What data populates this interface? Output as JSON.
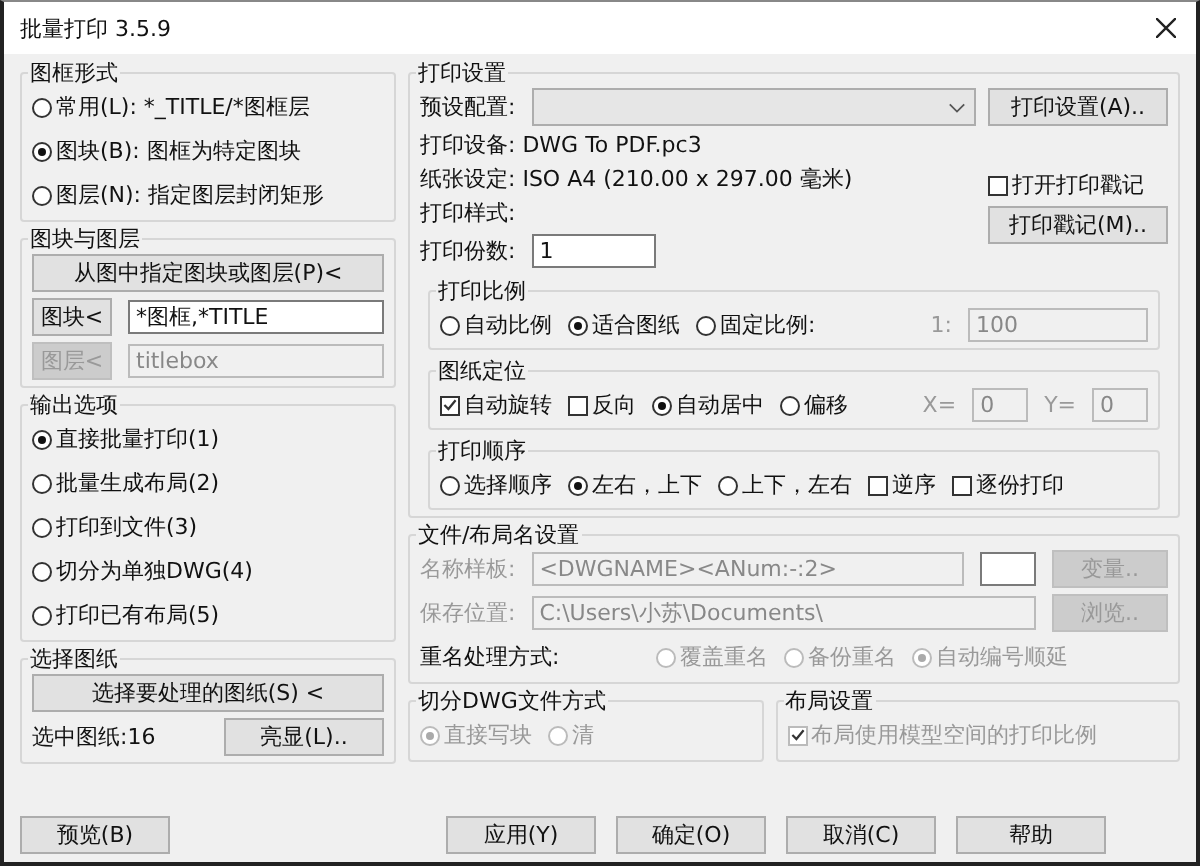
{
  "window": {
    "title": "批量打印 3.5.9"
  },
  "frame_type": {
    "label": "图框形式",
    "options": [
      {
        "label": "常用(L): *_TITLE/*图框层",
        "selected": false
      },
      {
        "label": "图块(B): 图框为特定图块",
        "selected": true
      },
      {
        "label": "图层(N): 指定图层封闭矩形",
        "selected": false
      }
    ]
  },
  "block_layer": {
    "label": "图块与图层",
    "pick_button": "从图中指定图块或图层(P)<",
    "block_button": {
      "label": "图块<",
      "disabled": false
    },
    "block_value": "*图框,*TITLE",
    "layer_button": {
      "label": "图层<",
      "disabled": true
    },
    "layer_value": "titlebox"
  },
  "output": {
    "label": "输出选项",
    "options": [
      {
        "label": "直接批量打印(1)",
        "selected": true
      },
      {
        "label": "批量生成布局(2)",
        "selected": false
      },
      {
        "label": "打印到文件(3)",
        "selected": false
      },
      {
        "label": "切分为单独DWG(4)",
        "selected": false
      },
      {
        "label": "打印已有布局(5)",
        "selected": false
      }
    ]
  },
  "sheets": {
    "label": "选择图纸",
    "select_button": "选择要处理的图纸(S) <",
    "count": "选中图纸:16",
    "highlight_button": "亮显(L).."
  },
  "print_settings": {
    "label": "打印设置",
    "preset_label": "预设配置:",
    "setup_button": "打印设置(A)..",
    "device": "打印设备: DWG To PDF.pc3",
    "paper": "纸张设定: ISO A4 (210.00 x 297.00 毫米)",
    "style": "打印样式:",
    "copies_label": "打印份数:",
    "copies_value": "1",
    "stamp_check": {
      "label": "打开打印戳记",
      "checked": false
    },
    "stamp_button": "打印戳记(M).."
  },
  "scale": {
    "label": "打印比例",
    "options": [
      {
        "label": "自动比例",
        "selected": false
      },
      {
        "label": "适合图纸",
        "selected": true
      },
      {
        "label": "固定比例:",
        "selected": false
      }
    ],
    "ratio_prefix": "1:",
    "ratio_value": "100",
    "ratio_disabled": true
  },
  "position": {
    "label": "图纸定位",
    "items": [
      {
        "kind": "checkbox",
        "label": "自动旋转",
        "checked": true
      },
      {
        "kind": "checkbox",
        "label": "反向",
        "checked": false
      },
      {
        "kind": "radio",
        "label": "自动居中",
        "selected": true
      },
      {
        "kind": "radio",
        "label": "偏移",
        "selected": false
      }
    ],
    "x_label": "X=",
    "x_value": "0",
    "y_label": "Y=",
    "y_value": "0",
    "offset_disabled": true
  },
  "order": {
    "label": "打印顺序",
    "items": [
      {
        "kind": "radio",
        "label": "选择顺序",
        "selected": false
      },
      {
        "kind": "radio",
        "label": "左右，上下",
        "selected": true
      },
      {
        "kind": "radio",
        "label": "上下，左右",
        "selected": false
      },
      {
        "kind": "checkbox",
        "label": "逆序",
        "checked": false
      },
      {
        "kind": "checkbox",
        "label": "逐份打印",
        "checked": false
      }
    ]
  },
  "file_names": {
    "label": "文件/布局名设置",
    "disabled": true,
    "template_label": "名称样板:",
    "template_value": "<DWGNAME><ANum:-:2>",
    "variable_button": "变量..",
    "location_label": "保存位置:",
    "location_value": "C:\\Users\\小苏\\Documents\\",
    "browse_button": "浏览..",
    "rename_label": "重名处理方式:",
    "rename_options": [
      {
        "label": "覆盖重名",
        "selected": false
      },
      {
        "label": "备份重名",
        "selected": false
      },
      {
        "label": "自动编号顺延",
        "selected": true
      }
    ]
  },
  "split_dwg": {
    "label": "切分DWG文件方式",
    "disabled": true,
    "options": [
      {
        "label": "直接写块",
        "selected": true
      },
      {
        "label": "清",
        "selected": false
      }
    ]
  },
  "layout": {
    "label": "布局设置",
    "disabled": true,
    "check": {
      "label": "布局使用模型空间的打印比例",
      "checked": true
    }
  },
  "buttons": [
    {
      "label": "预览(B)"
    },
    {
      "label": "应用(Y)"
    },
    {
      "label": "确定(O)"
    },
    {
      "label": "取消(C)"
    },
    {
      "label": "帮助"
    }
  ]
}
